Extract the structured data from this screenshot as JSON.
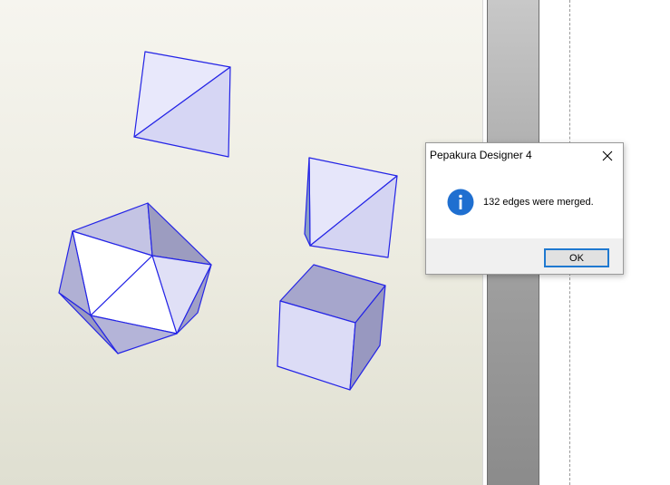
{
  "dialog": {
    "title": "Pepakura Designer 4",
    "message": "132 edges were merged.",
    "ok_label": "OK",
    "icon": "info-icon",
    "close_icon": "close-icon",
    "accent_color": "#1f79d0"
  },
  "viewport": {
    "models": [
      "octahedron",
      "tetrahedron",
      "icosahedron",
      "cube"
    ],
    "edge_color": "#2020e0",
    "face_color": "#dcdcf6",
    "shade_color": "#a8a8d0"
  }
}
